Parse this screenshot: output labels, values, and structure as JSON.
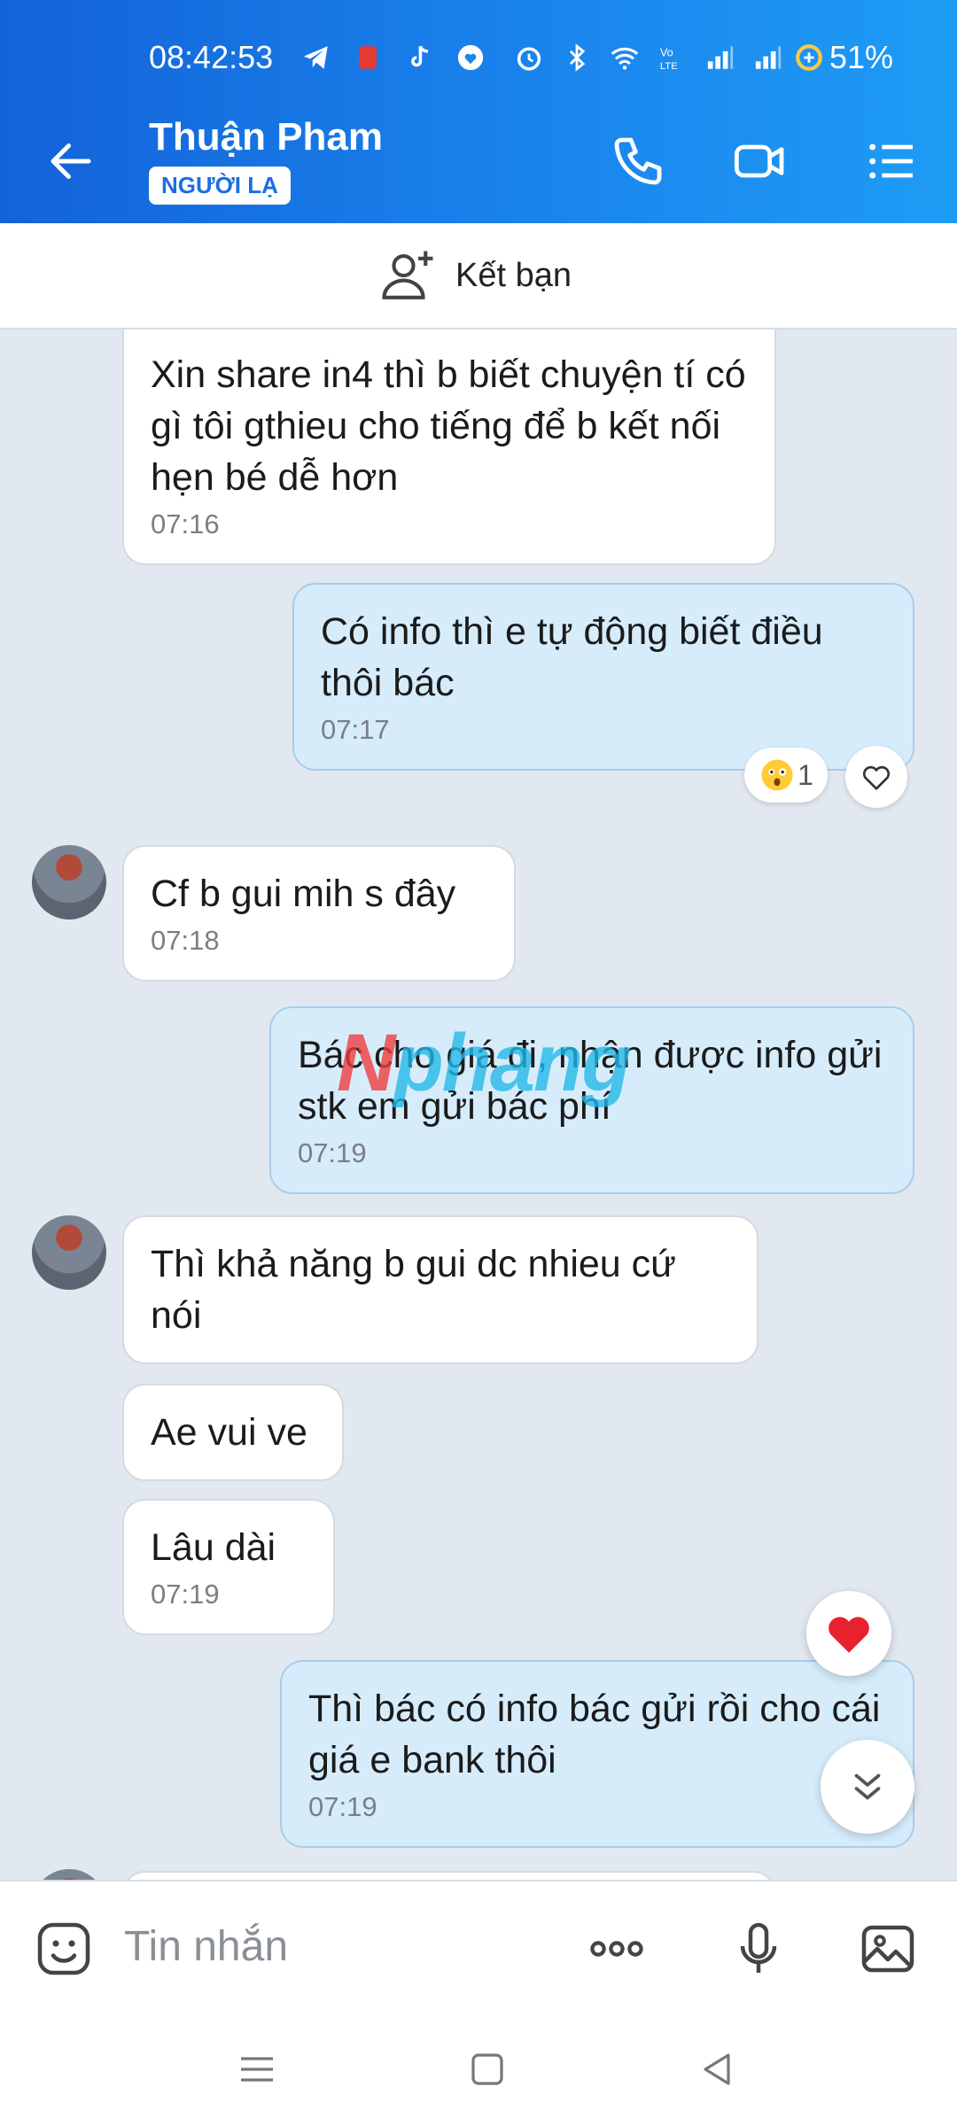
{
  "status": {
    "time": "08:42:53",
    "battery": "51%"
  },
  "header": {
    "title": "Thuận Pham",
    "badge": "NGƯỜI LẠ"
  },
  "add_friend": {
    "label": "Kết bạn"
  },
  "messages": [
    {
      "dir": "in",
      "text": "Xin share in4 thì b biết chuyện tí có gì tôi gthieu cho tiếng để b kết nối hẹn bé dễ hơn",
      "time": "07:16"
    },
    {
      "dir": "out",
      "text": "Có info thì e tự động biết điều thôi bác",
      "time": "07:17",
      "reaction_count": "1"
    },
    {
      "dir": "in",
      "text": "Cf b gui mih s đây",
      "time": "07:18"
    },
    {
      "dir": "out",
      "text": "Bác cho giá đi, nhận được info gửi stk em gửi bác phí",
      "time": "07:19"
    },
    {
      "dir": "in",
      "text": "Thì khả năng b gui dc nhieu cứ nói",
      "time": ""
    },
    {
      "dir": "in",
      "text": "Ae vui ve",
      "time": ""
    },
    {
      "dir": "in",
      "text": "Lâu dài",
      "time": "07:19"
    },
    {
      "dir": "out",
      "text": "Thì bác có info bác gửi rồi cho cái giá e bank thôi",
      "time": "07:19"
    }
  ],
  "watermark": {
    "part1": "N",
    "part2": "phang"
  },
  "input": {
    "placeholder": "Tin nhắn"
  },
  "colors": {
    "header": "#1a86ee",
    "bubble_out": "#d6ecfb",
    "bubble_in": "#ffffff",
    "background": "#e2e8ef"
  }
}
